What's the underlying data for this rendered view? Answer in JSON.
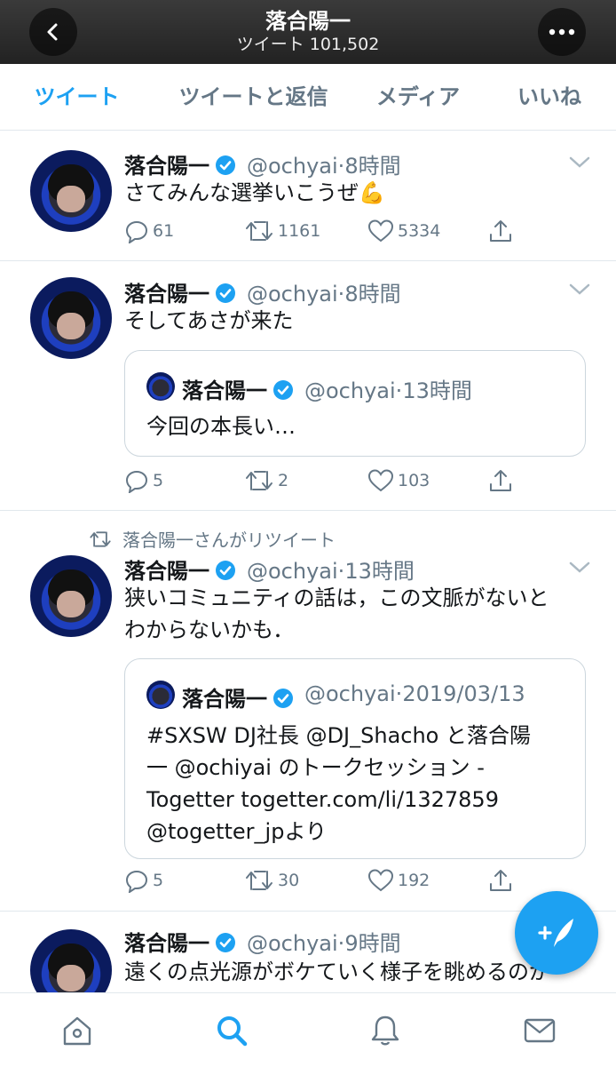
{
  "header": {
    "title": "落合陽一",
    "subtitle": "ツイート 101,502"
  },
  "tabs": [
    {
      "label": "ツイート"
    },
    {
      "label": "ツイートと返信"
    },
    {
      "label": "メディア"
    },
    {
      "label": "いいね"
    }
  ],
  "tweets": [
    {
      "name": "落合陽一",
      "handle": "@ochyai",
      "time": "8時間",
      "text": "さてみんな選挙いこうぜ💪",
      "replies": "61",
      "retweets": "1161",
      "likes": "5334"
    },
    {
      "name": "落合陽一",
      "handle": "@ochyai",
      "time": "8時間",
      "text": "そしてあさが来た",
      "quote": {
        "name": "落合陽一",
        "handle": "@ochyai",
        "time": "13時間",
        "text": "今回の本長い…"
      },
      "replies": "5",
      "retweets": "2",
      "likes": "103"
    },
    {
      "retweeted_by": "落合陽一さんがリツイート",
      "name": "落合陽一",
      "handle": "@ochyai",
      "time": "13時間",
      "text_lines": [
        "狭いコミュニティの話は，この文脈がないと",
        "わからないかも．"
      ],
      "quote": {
        "name": "落合陽一",
        "handle": "@ochyai",
        "time": "2019/03/13",
        "text_lines": [
          "#SXSW DJ社長 @DJ_Shacho と落合陽",
          "一 @ochiyai のトークセッション -",
          "Togetter togetter.com/li/1327859",
          "@togetter_jpより"
        ]
      },
      "replies": "5",
      "retweets": "30",
      "likes": "192"
    },
    {
      "name": "落合陽一",
      "handle": "@ochyai",
      "time": "9時間",
      "text": "遠くの点光源がボケていく様子を眺めるのが"
    }
  ],
  "colors": {
    "accent": "#1da1f2",
    "secondary_text": "#657786",
    "verified": "#1da1f2"
  },
  "icons": {
    "back": "chevron-left-icon",
    "more": "more-icon",
    "compose": "compose-icon"
  },
  "bottom_nav": [
    "home-icon",
    "search-icon",
    "notifications-icon",
    "messages-icon"
  ],
  "separator": "·"
}
